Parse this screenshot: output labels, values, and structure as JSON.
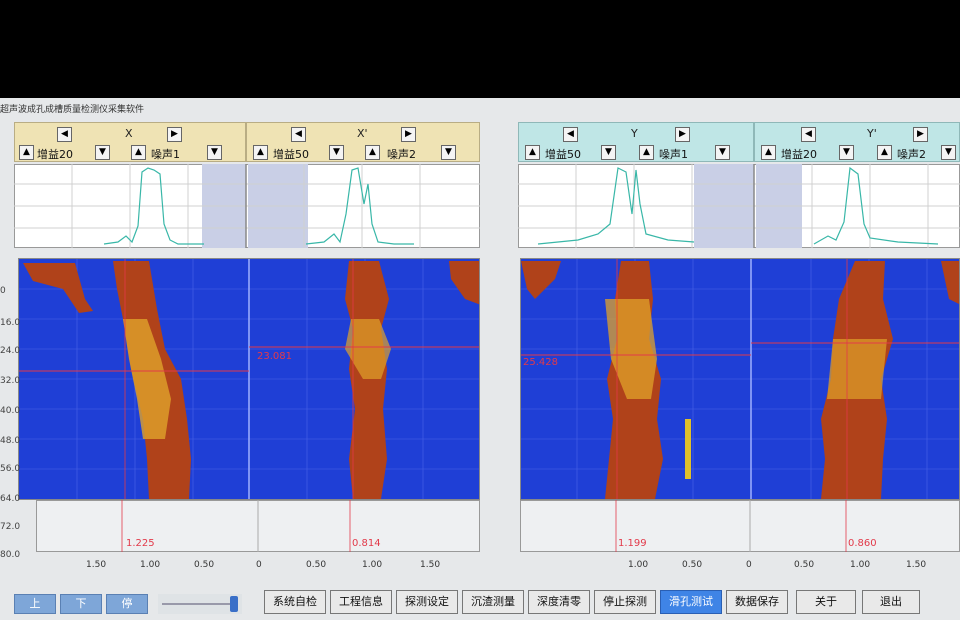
{
  "app_title": "超声波成孔成槽质量检测仪采集软件",
  "channels": [
    {
      "axis": "X",
      "gain": "增益20",
      "noise": "噪声1",
      "marker": "",
      "reading": "1.225"
    },
    {
      "axis": "X'",
      "gain": "增益50",
      "noise": "噪声2",
      "marker": "23.081",
      "reading": "0.814"
    },
    {
      "axis": "Y",
      "gain": "增益50",
      "noise": "噪声1",
      "marker": "25.428",
      "reading": "1.199"
    },
    {
      "axis": "Y'",
      "gain": "增益20",
      "noise": "噪声2",
      "marker": "",
      "reading": "0.860"
    }
  ],
  "depth_left": [
    "0",
    "16.0",
    "24.0",
    "32.0",
    "40.0",
    "48.0",
    "56.0",
    "64.0",
    "72.0",
    "80.0"
  ],
  "x_ticks": [
    "1.50",
    "1.00",
    "0.50",
    "0",
    "0.50",
    "1.00",
    "1.50",
    "1.00",
    "0.50",
    "0",
    "0.50",
    "1.00",
    "1.50"
  ],
  "nav": {
    "up": "上",
    "down": "下",
    "stop": "停"
  },
  "buttons": [
    "系统自检",
    "工程信息",
    "探测设定",
    "沉渣测量",
    "深度清零",
    "停止探测",
    "滑孔测试",
    "数据保存",
    "关于",
    "退出"
  ],
  "active_button": "滑孔测试",
  "colors": {
    "scan_bg": "#1f3fd6",
    "trace": "#c0471a",
    "marker": "#e23a4a",
    "active_btn": "#3f84e6"
  }
}
